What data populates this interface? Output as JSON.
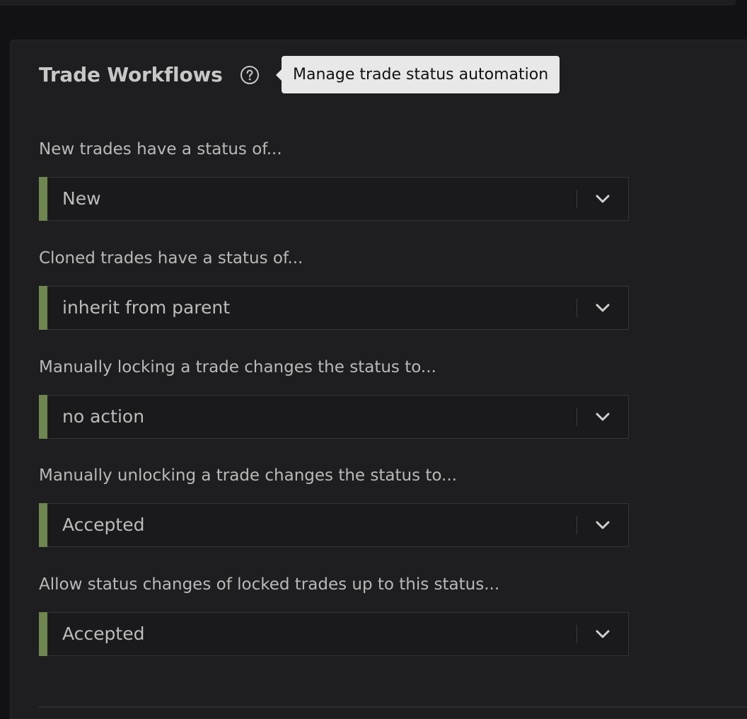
{
  "section": {
    "title": "Trade Workflows",
    "help_icon": "question-circle-icon",
    "tooltip": "Manage trade status automation"
  },
  "fields": [
    {
      "label": "New trades have a status of...",
      "value": "New"
    },
    {
      "label": "Cloned trades have a status of...",
      "value": "inherit from parent"
    },
    {
      "label": "Manually locking a trade changes the status to...",
      "value": "no action"
    },
    {
      "label": "Manually unlocking a trade changes the status to...",
      "value": "Accepted"
    },
    {
      "label": "Allow status changes of locked trades up to this status...",
      "value": "Accepted"
    }
  ],
  "dropdown_icon": "chevron-down-icon",
  "colors": {
    "background": "#121214",
    "card": "#1e1e21",
    "accent": "#6f8650",
    "tooltip_bg": "#e8e8e8"
  }
}
